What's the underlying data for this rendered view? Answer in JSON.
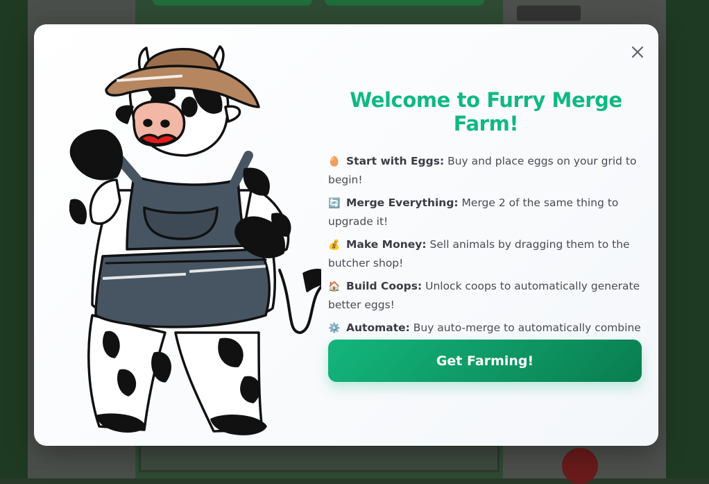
{
  "modal": {
    "title": "Welcome to Furry Merge Farm!",
    "features": [
      {
        "icon": "egg-icon",
        "emoji": "🥚",
        "label": "Start with Eggs:",
        "text": " Buy and place eggs on your grid to begin!"
      },
      {
        "icon": "merge-icon",
        "emoji": "🔄",
        "label": "Merge Everything:",
        "text": " Merge 2 of the same thing to upgrade it!"
      },
      {
        "icon": "money-bag-icon",
        "emoji": "💰",
        "label": "Make Money:",
        "text": " Sell animals by dragging them to the butcher shop!"
      },
      {
        "icon": "coop-icon",
        "emoji": "🏠",
        "label": "Build Coops:",
        "text": " Unlock coops to automatically generate better eggs!"
      },
      {
        "icon": "gear-icon",
        "emoji": "⚙️",
        "label": "Automate:",
        "text": " Buy auto-merge to automatically combine animals and eggs!"
      }
    ],
    "cta_label": "Get Farming!"
  },
  "colors": {
    "accent": "#10b981",
    "button_start": "#13b67d",
    "button_end": "#0a7d4f"
  }
}
